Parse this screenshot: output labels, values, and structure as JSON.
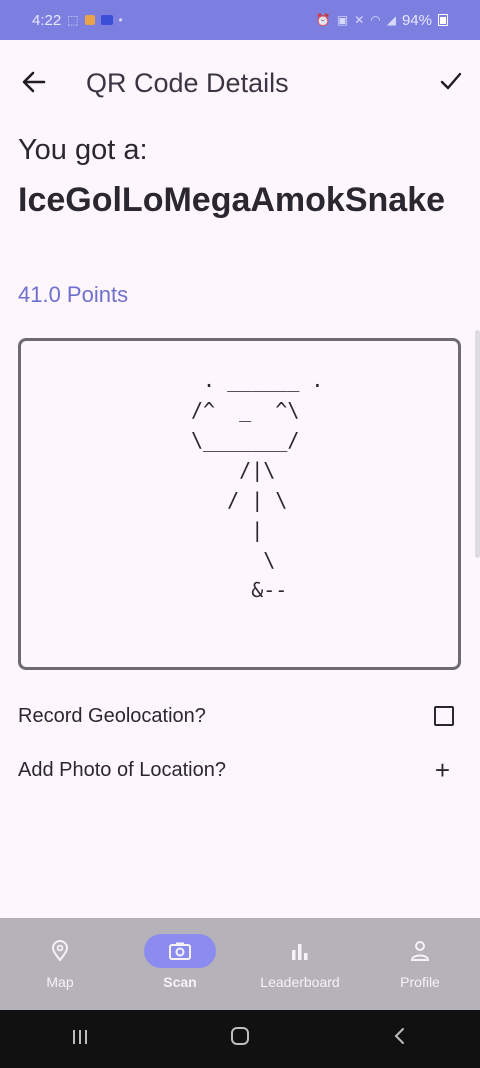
{
  "status_bar": {
    "time": "4:22",
    "battery": "94%"
  },
  "app_bar": {
    "back_icon": "arrow-left-icon",
    "title": "QR Code Details",
    "confirm_icon": "checkmark-icon"
  },
  "result": {
    "prefix": "You got a:",
    "name": "IceGolLoMegaAmokSnake",
    "points": "41.0 Points"
  },
  "visual": {
    "art": " . ______ .\n/^  _  ^\\\n\\_______/\n    /|\\\n   / | \\\n     |\n      \\\n     &--"
  },
  "options": [
    {
      "label": "Record Geolocation?",
      "control": "checkbox",
      "checked": false
    },
    {
      "label": "Add Photo of Location?",
      "control": "plus-icon"
    }
  ],
  "bottom_nav": [
    {
      "label": "Map",
      "icon": "map-pin-icon",
      "active": false
    },
    {
      "label": "Scan",
      "icon": "camera-icon",
      "active": true
    },
    {
      "label": "Leaderboard",
      "icon": "bar-chart-icon",
      "active": false
    },
    {
      "label": "Profile",
      "icon": "person-icon",
      "active": false
    }
  ],
  "colors": {
    "accent": "#6f6fd0",
    "status_bar": "#7d7fe0",
    "nav_active_pill": "#8c8cf0",
    "nav_bg": "#b5b3b9"
  }
}
